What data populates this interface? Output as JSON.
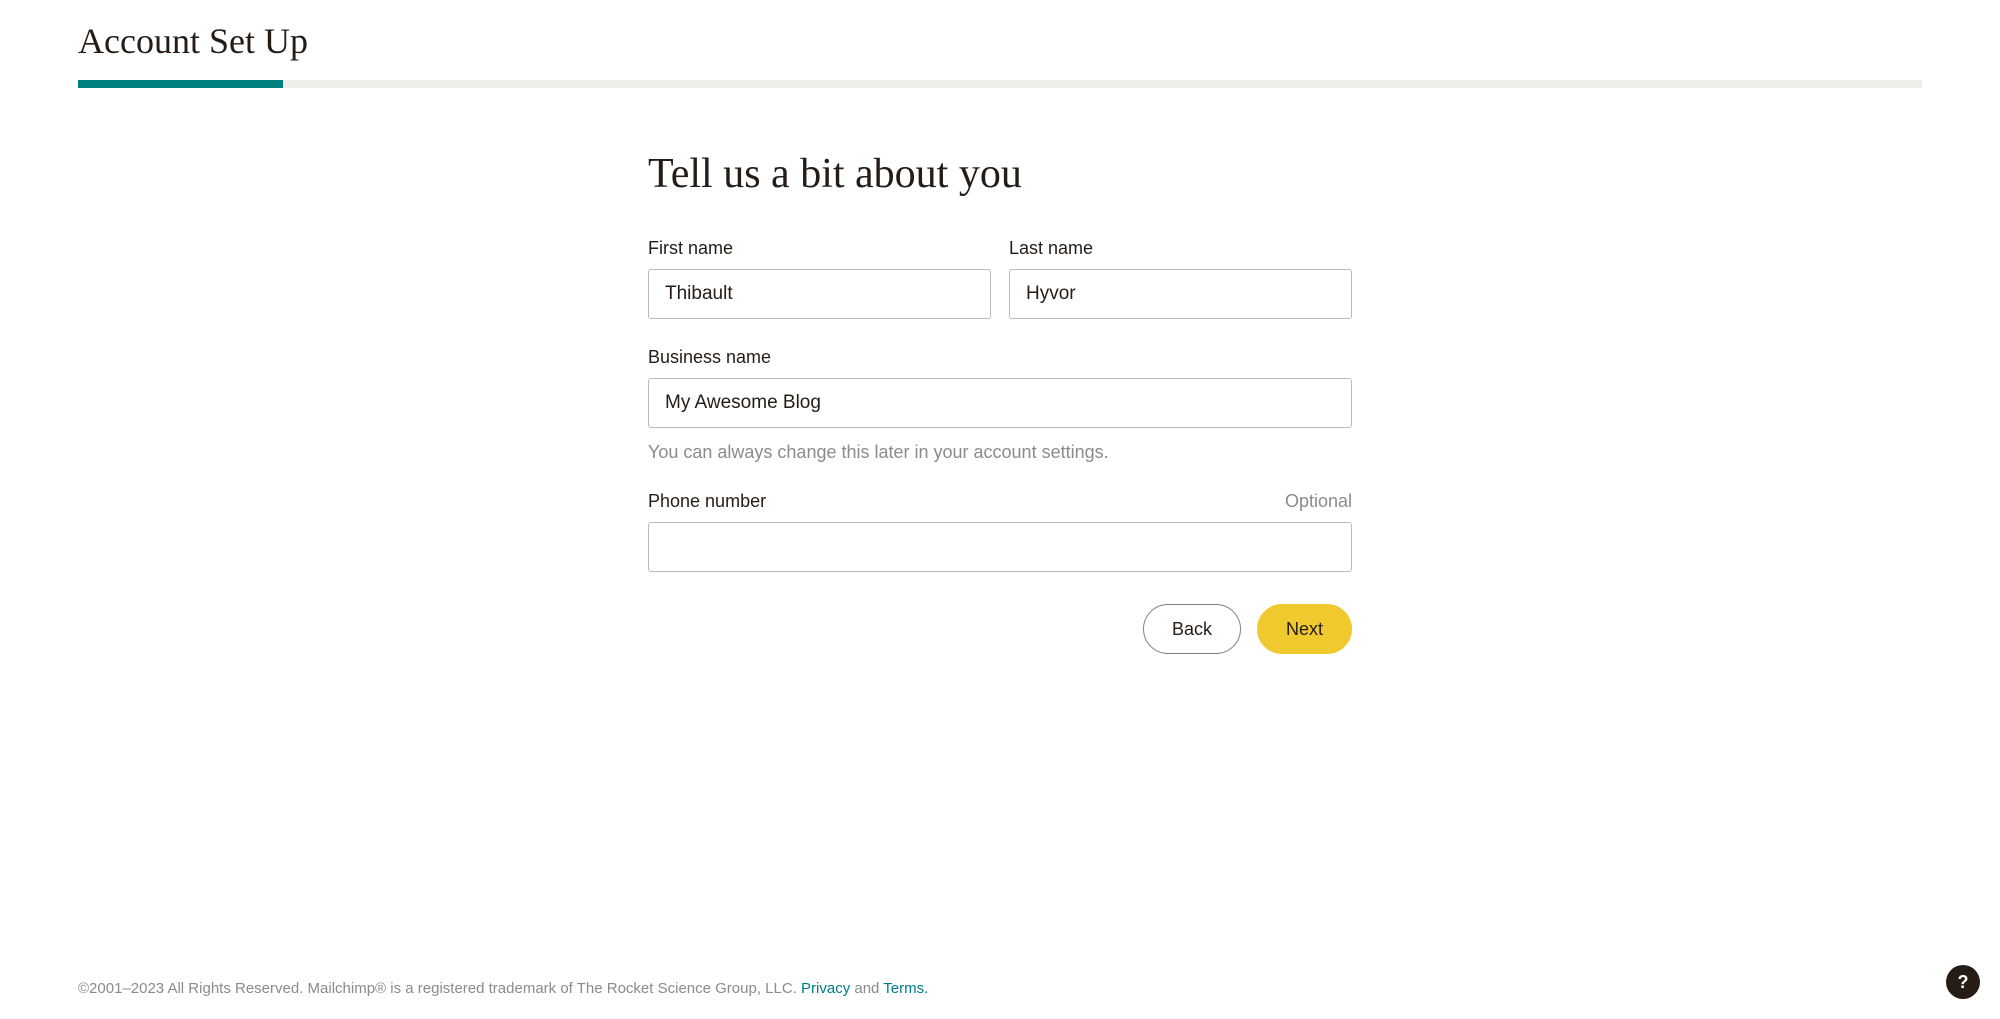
{
  "header": {
    "title": "Account Set Up"
  },
  "progress": {
    "percent": 11.1
  },
  "form": {
    "heading": "Tell us a bit about you",
    "first_name": {
      "label": "First name",
      "value": "Thibault"
    },
    "last_name": {
      "label": "Last name",
      "value": "Hyvor"
    },
    "business_name": {
      "label": "Business name",
      "value": "My Awesome Blog",
      "helper": "You can always change this later in your account settings."
    },
    "phone": {
      "label": "Phone number",
      "optional": "Optional",
      "value": ""
    },
    "buttons": {
      "back": "Back",
      "next": "Next"
    }
  },
  "footer": {
    "copyright": "©2001–2023 All Rights Reserved. Mailchimp® is a registered trademark of The Rocket Science Group, LLC. ",
    "privacy": "Privacy",
    "and": " and ",
    "terms": "Terms.",
    "help_label": "?"
  }
}
